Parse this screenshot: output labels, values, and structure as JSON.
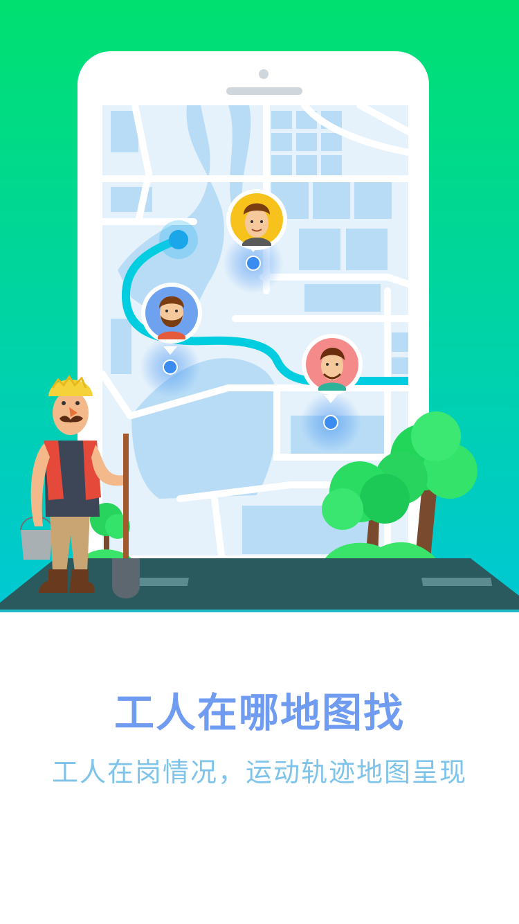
{
  "colors": {
    "bg_top": "#00e070",
    "bg_bottom": "#00c8d4",
    "map_water": "#b8dcf6",
    "map_land": "#e6f2fb",
    "route": "#00cde0",
    "marker": "#3a8cf0",
    "title": "#6f9cf0",
    "subtitle": "#7dc3ea"
  },
  "icons": {
    "phone": "phone-frame-icon",
    "route": "route-line-icon",
    "pin": "location-pin-icon",
    "worker": "worker-illustration",
    "tree": "tree-icon"
  },
  "screen": {
    "title": "工人在哪地图找",
    "subtitle": "工人在岗情况，运动轨迹地图呈现"
  }
}
